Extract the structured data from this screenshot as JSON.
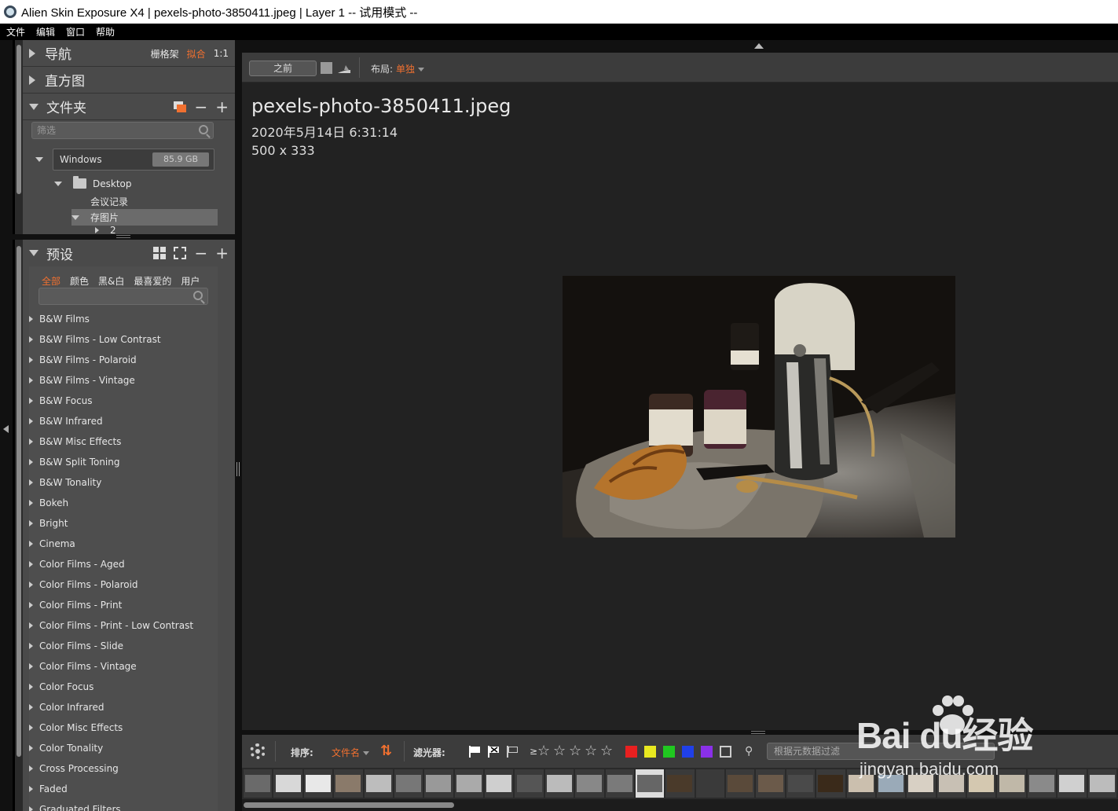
{
  "window": {
    "title": "Alien Skin Exposure X4 | pexels-photo-3850411.jpeg | Layer 1 -- 试用模式 --"
  },
  "menu": [
    "文件",
    "编辑",
    "窗口",
    "帮助"
  ],
  "nav": {
    "title": "导航",
    "opt1": "栅格架",
    "opt2": "拟合",
    "opt3": "1:1"
  },
  "histogram": {
    "title": "直方图"
  },
  "folders": {
    "title": "文件夹",
    "filter_placeholder": "筛选",
    "drive_name": "Windows",
    "drive_size": "85.9 GB",
    "tree": [
      "Desktop",
      "会议记录",
      "存图片",
      "2"
    ]
  },
  "presets": {
    "title": "预设",
    "tabs": [
      "全部",
      "颜色",
      "黑&白",
      "最喜爱的",
      "用户"
    ],
    "items": [
      "B&W Films",
      "B&W Films - Low Contrast",
      "B&W Films - Polaroid",
      "B&W Films - Vintage",
      "B&W Focus",
      "B&W Infrared",
      "B&W Misc Effects",
      "B&W Split Toning",
      "B&W Tonality",
      "Bokeh",
      "Bright",
      "Cinema",
      "Color Films - Aged",
      "Color Films - Polaroid",
      "Color Films - Print",
      "Color Films - Print - Low Contrast",
      "Color Films - Slide",
      "Color Films - Vintage",
      "Color Focus",
      "Color Infrared",
      "Color Misc Effects",
      "Color Tonality",
      "Cross Processing",
      "Faded",
      "Graduated Filters"
    ]
  },
  "toolbar": {
    "before_label": "之前",
    "layout_label": "布局:",
    "layout_value": "单独"
  },
  "image_info": {
    "filename": "pexels-photo-3850411.jpeg",
    "date": "2020年5月14日 6:31:14",
    "dimensions": "500 x 333"
  },
  "filmstrip": {
    "sort_label": "排序:",
    "sort_value": "文件名",
    "filter_label": "滤光器:",
    "rating_prefix": "≥",
    "stars": [
      "☆",
      "☆",
      "☆",
      "☆",
      "☆"
    ],
    "color_labels": [
      "#e82020",
      "#e8e820",
      "#20c820",
      "#2040e8",
      "#8a30e8"
    ],
    "meta_filter_placeholder": "根据元数据过滤"
  },
  "watermark": {
    "brand": "Bai du经验",
    "url": "jingyan.baidu.com"
  },
  "colors": {
    "accent": "#f07030",
    "panel": "#4a4a4a",
    "main_bg": "#222222"
  }
}
